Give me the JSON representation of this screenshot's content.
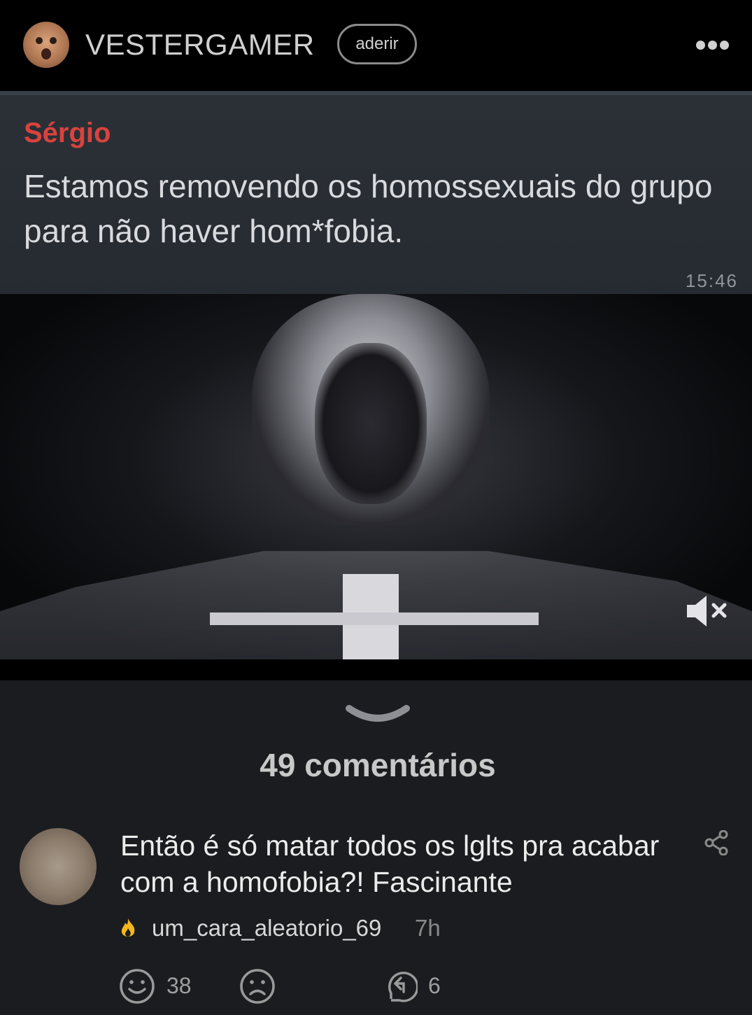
{
  "header": {
    "channel_name": "VESTERGAMER",
    "join_label": "aderir",
    "avatar_icon": "profile-avatar",
    "more_icon": "more-dots-icon"
  },
  "media": {
    "sender": "Sérgio",
    "message": "Estamos removendo os homossexuais do grupo para não haver hom*fobia.",
    "time": "15:46",
    "mute_icon": "muted-speaker-icon"
  },
  "comments": {
    "count_label": "49 comentários",
    "items": [
      {
        "text": "Então é só matar todos os lglts pra acabar com a homofobia?! Fascinante",
        "username": "um_cara_aleatorio_69",
        "age": "7h",
        "likes": "38",
        "replies": "6"
      }
    ]
  },
  "colors": {
    "background": "#1b1c20",
    "header": "#000000",
    "sender": "#d9433d",
    "fire": "#f2b81c"
  }
}
